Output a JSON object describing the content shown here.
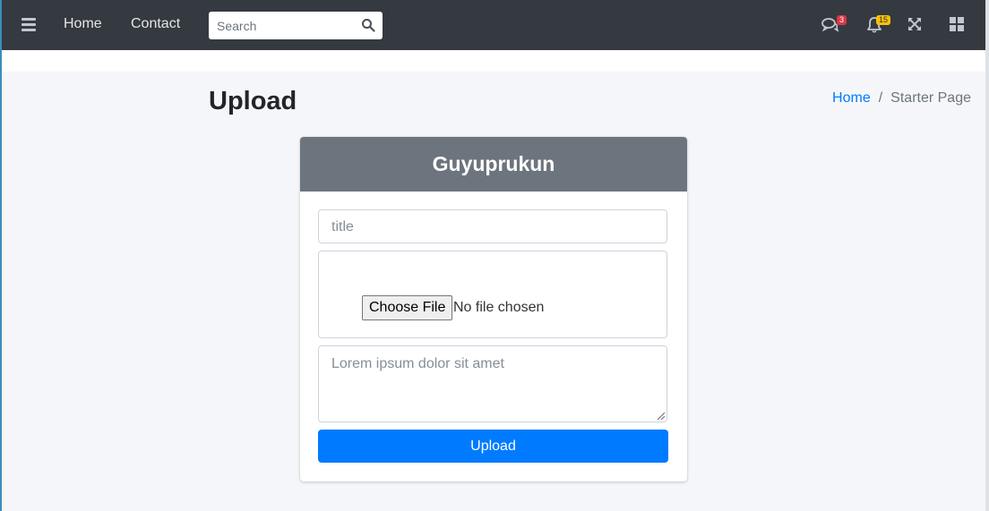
{
  "navbar": {
    "links": [
      {
        "label": "Home"
      },
      {
        "label": "Contact"
      }
    ],
    "search": {
      "placeholder": "Search",
      "value": ""
    },
    "messages_badge": "3",
    "notifications_badge": "15",
    "icons": [
      "menu-icon",
      "search-icon",
      "comments-icon",
      "bell-icon",
      "expand-icon",
      "grid-icon"
    ]
  },
  "page": {
    "title": "Upload",
    "breadcrumb": [
      {
        "label": "Home"
      },
      {
        "label": "Starter Page"
      }
    ],
    "breadcrumb_separator": "/"
  },
  "form": {
    "header": "Guyuprukun",
    "title_placeholder": "title",
    "title_value": "",
    "file_button_label": "Choose File",
    "file_status": "No file chosen",
    "description_placeholder": "Lorem ipsum dolor sit amet",
    "description_value": "",
    "submit_label": "Upload"
  },
  "colors": {
    "navbar": "#343a40",
    "card_header": "#6c757d",
    "primary": "#007bff",
    "badge_danger": "#dc3545",
    "badge_warning": "#ffc107"
  }
}
